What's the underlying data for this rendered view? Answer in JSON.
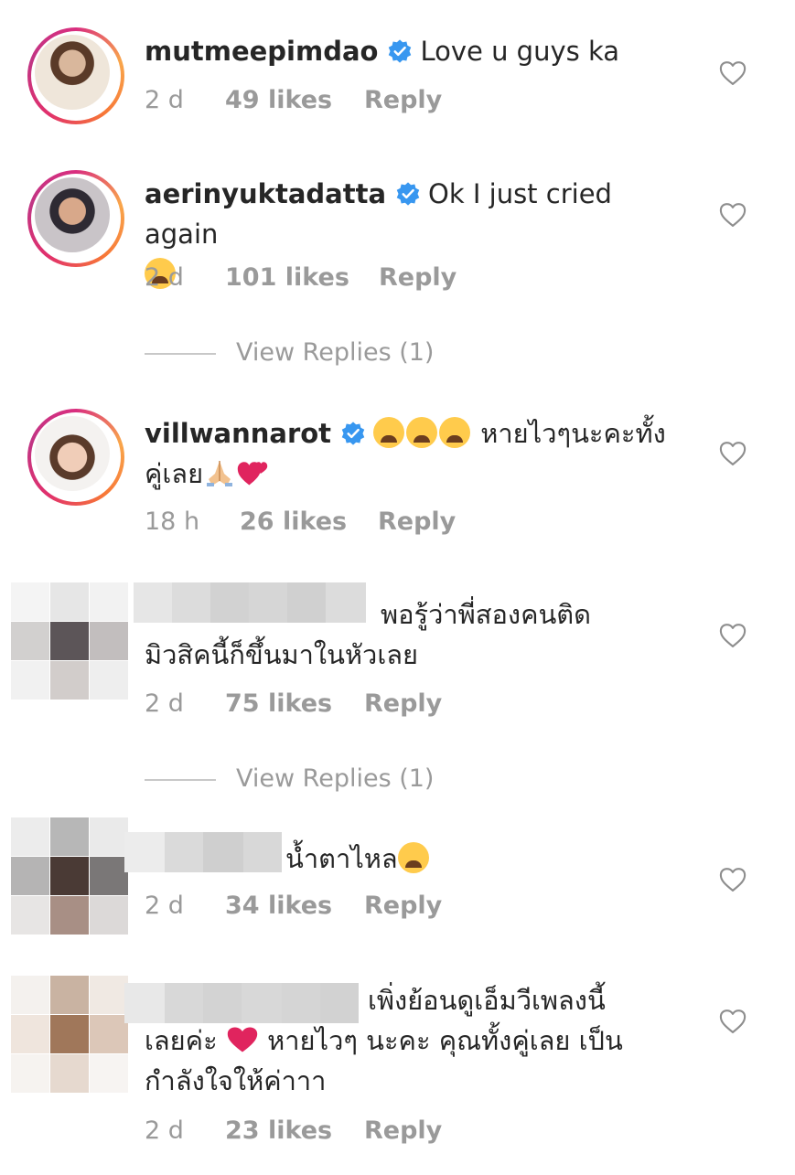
{
  "comments": [
    {
      "username": "mutmeepimdao",
      "verified": true,
      "text": "Love u guys ka",
      "time": "2 d",
      "likes": "49 likes",
      "reply": "Reply"
    },
    {
      "username": "aerinyuktadatta",
      "verified": true,
      "text": "Ok I just cried again",
      "emoji": "crying-face",
      "time": "2 d",
      "likes": "101 likes",
      "reply": "Reply",
      "view_replies": "View Replies (1)"
    },
    {
      "username": "villwannarot",
      "verified": true,
      "text_line1": "หายไวๆนะคะทั้ง",
      "text_line2": "คู่เลย",
      "emoji": "crying-face",
      "time": "18 h",
      "likes": "26 likes",
      "reply": "Reply"
    },
    {
      "username_hidden": true,
      "text_line1": "พอรู้ว่าพี่สองคนติด",
      "text_line2": "มิวสิคนี้ก็ขึ้นมาในหัวเลย",
      "time": "2 d",
      "likes": "75 likes",
      "reply": "Reply",
      "view_replies": "View Replies (1)"
    },
    {
      "username_hidden": true,
      "text": "น้ำตาไหล",
      "emoji": "crying-face",
      "time": "2 d",
      "likes": "34 likes",
      "reply": "Reply"
    },
    {
      "username_hidden": true,
      "text_line1": "เพิ่งย้อนดูเอ็มวีเพลงนี้",
      "text_line2a": "เลยค่ะ",
      "text_line2b": "หายไวๆ นะคะ คุณทั้งคู่เลย เป็น",
      "text_line3": "กำลังใจให้ค่าาา",
      "time": "2 d",
      "likes": "23 likes",
      "reply": "Reply"
    }
  ],
  "colors": {
    "verified_blue": "#3897f0",
    "meta_gray": "#9a9a9a",
    "heart_red": "#e0245e"
  },
  "icons": {
    "like": "heart-outline-icon",
    "verified": "verified-badge-icon"
  }
}
